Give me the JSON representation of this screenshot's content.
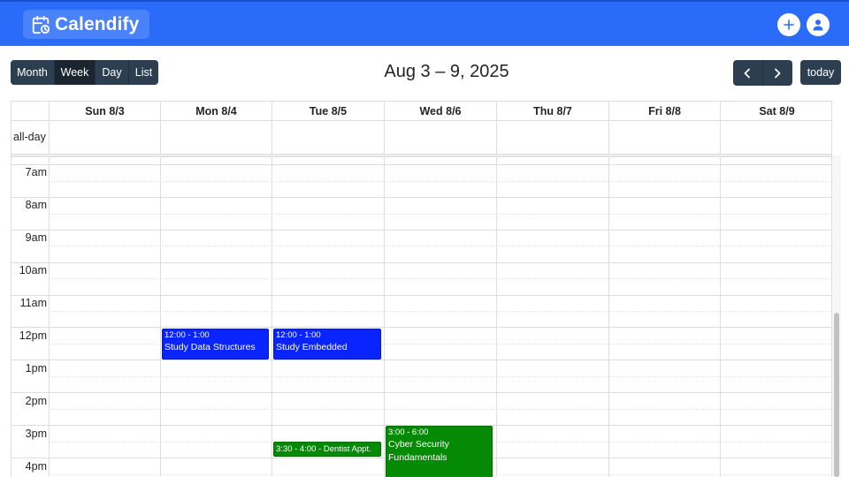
{
  "app": {
    "name": "Calendify"
  },
  "toolbar": {
    "views": [
      "Month",
      "Week",
      "Day",
      "List"
    ],
    "active_view": "Week",
    "range_title": "Aug 3 – 9, 2025",
    "today_label": "today"
  },
  "calendar": {
    "days": [
      "Sun 8/3",
      "Mon 8/4",
      "Tue 8/5",
      "Wed 8/6",
      "Thu 8/7",
      "Fri 8/8",
      "Sat 8/9"
    ],
    "allday_label": "all-day",
    "hours": [
      "7am",
      "8am",
      "9am",
      "10am",
      "11am",
      "12pm",
      "1pm",
      "2pm",
      "3pm",
      "4pm"
    ],
    "events": [
      {
        "day": "Mon 8/4",
        "time": "12:00 - 1:00",
        "title": "Study Data Structures",
        "color": "#0a24ff"
      },
      {
        "day": "Tue 8/5",
        "time": "12:00 - 1:00",
        "title": "Study Embedded",
        "color": "#0a24ff"
      },
      {
        "day": "Tue 8/5",
        "time": "3:30 - 4:00",
        "title": "Dentist Appt.",
        "color": "#058a05"
      },
      {
        "day": "Wed 8/6",
        "time": "3:00 - 6:00",
        "title": "Cyber Security Fundamentals",
        "color": "#058a05"
      }
    ]
  },
  "icons": {
    "brand": "calendar-clock-icon",
    "add": "plus-icon",
    "user": "user-icon",
    "prev": "chevron-left-icon",
    "next": "chevron-right-icon"
  },
  "colors": {
    "header": "#2a6cf9",
    "buttons": "#2c3e50",
    "event_blue": "#0a24ff",
    "event_green": "#058a05"
  }
}
